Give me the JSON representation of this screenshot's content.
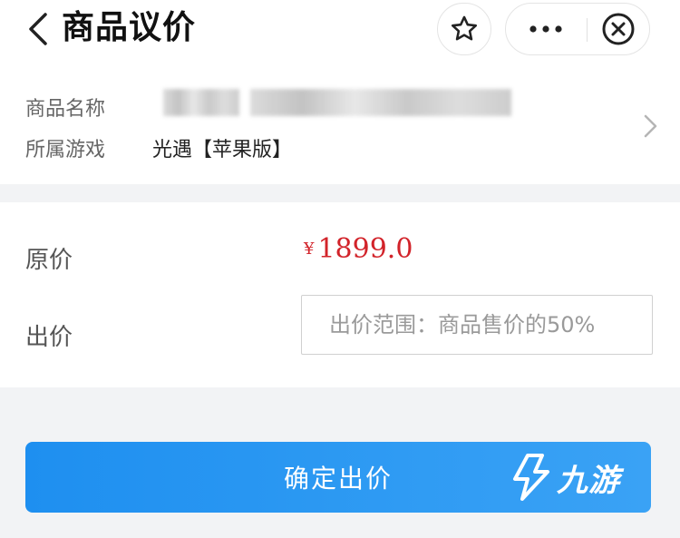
{
  "header": {
    "title": "商品议价",
    "icons": {
      "back": "chevron-left-icon",
      "star": "star-icon",
      "more": "more-dots-icon",
      "close": "close-circle-icon"
    }
  },
  "product": {
    "name_label": "商品名称",
    "game_label": "所属游戏",
    "game_value": "光遇【苹果版】"
  },
  "pricing": {
    "original_label": "原价",
    "currency": "¥",
    "original_price": "1899.0",
    "bid_label": "出价",
    "bid_placeholder": "出价范围：商品售价的50%",
    "bid_value": ""
  },
  "actions": {
    "confirm_label": "确定出价"
  },
  "watermark": {
    "text": "九游"
  },
  "colors": {
    "price_red": "#d2232a",
    "button_blue": "#2a96f2",
    "page_bg": "#f2f3f5"
  }
}
